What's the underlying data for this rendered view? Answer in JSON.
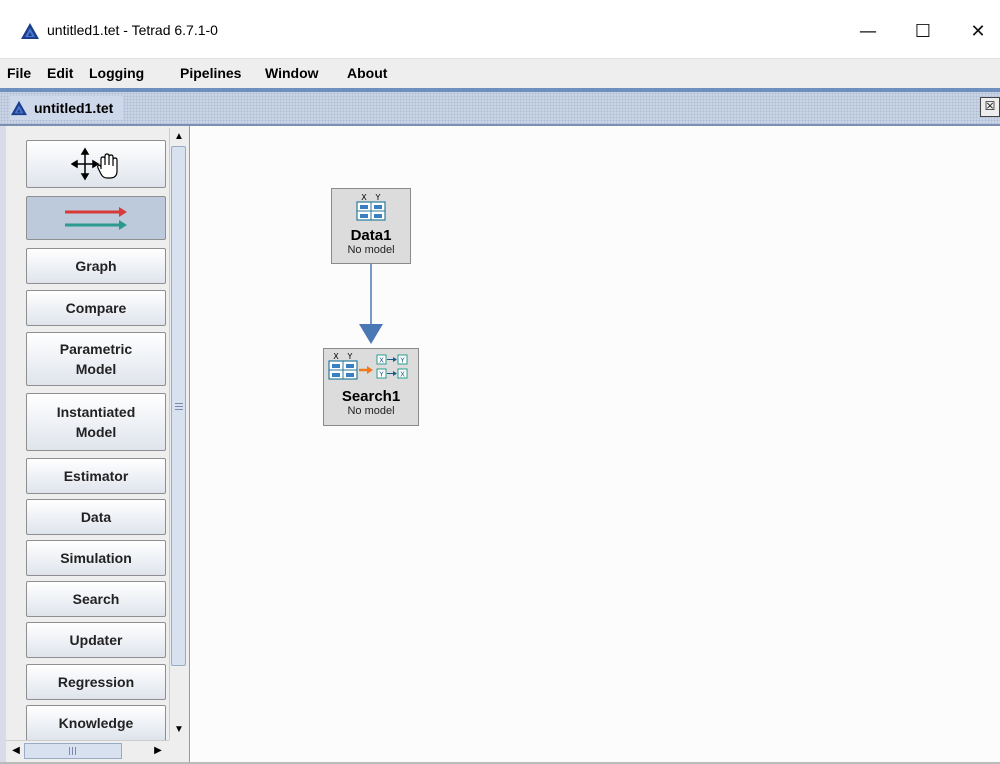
{
  "window": {
    "title": "untitled1.tet - Tetrad 6.7.1-0",
    "controls": {
      "minimize": "—",
      "maximize": "☐",
      "close": "✕"
    }
  },
  "menubar": {
    "items": [
      "File",
      "Edit",
      "Logging",
      "Pipelines",
      "Window",
      "About"
    ]
  },
  "internal_frame": {
    "title": "untitled1.tet",
    "close_glyph": "☒"
  },
  "toolbox": {
    "buttons": [
      {
        "label": "Graph"
      },
      {
        "label": "Compare"
      },
      {
        "label": "Parametric\nModel"
      },
      {
        "label": "Instantiated\nModel"
      },
      {
        "label": "Estimator"
      },
      {
        "label": "Data"
      },
      {
        "label": "Simulation"
      },
      {
        "label": "Search"
      },
      {
        "label": "Updater"
      },
      {
        "label": "Regression"
      },
      {
        "label": "Knowledge"
      }
    ]
  },
  "canvas": {
    "nodes": [
      {
        "name": "Data1",
        "status": "No model",
        "icon": "data-table-icon"
      },
      {
        "name": "Search1",
        "status": "No model",
        "icon": "search-data-icon"
      }
    ],
    "icon_letters": {
      "x": "X",
      "y": "Y"
    },
    "edge": {
      "from": "Data1",
      "to": "Search1",
      "color": "#4a78b4"
    }
  },
  "colors": {
    "accent": "#6f8fbf",
    "arrow_red": "#d83a3a",
    "arrow_teal": "#2c9a8e",
    "search_arrow": "#f07a1a"
  }
}
